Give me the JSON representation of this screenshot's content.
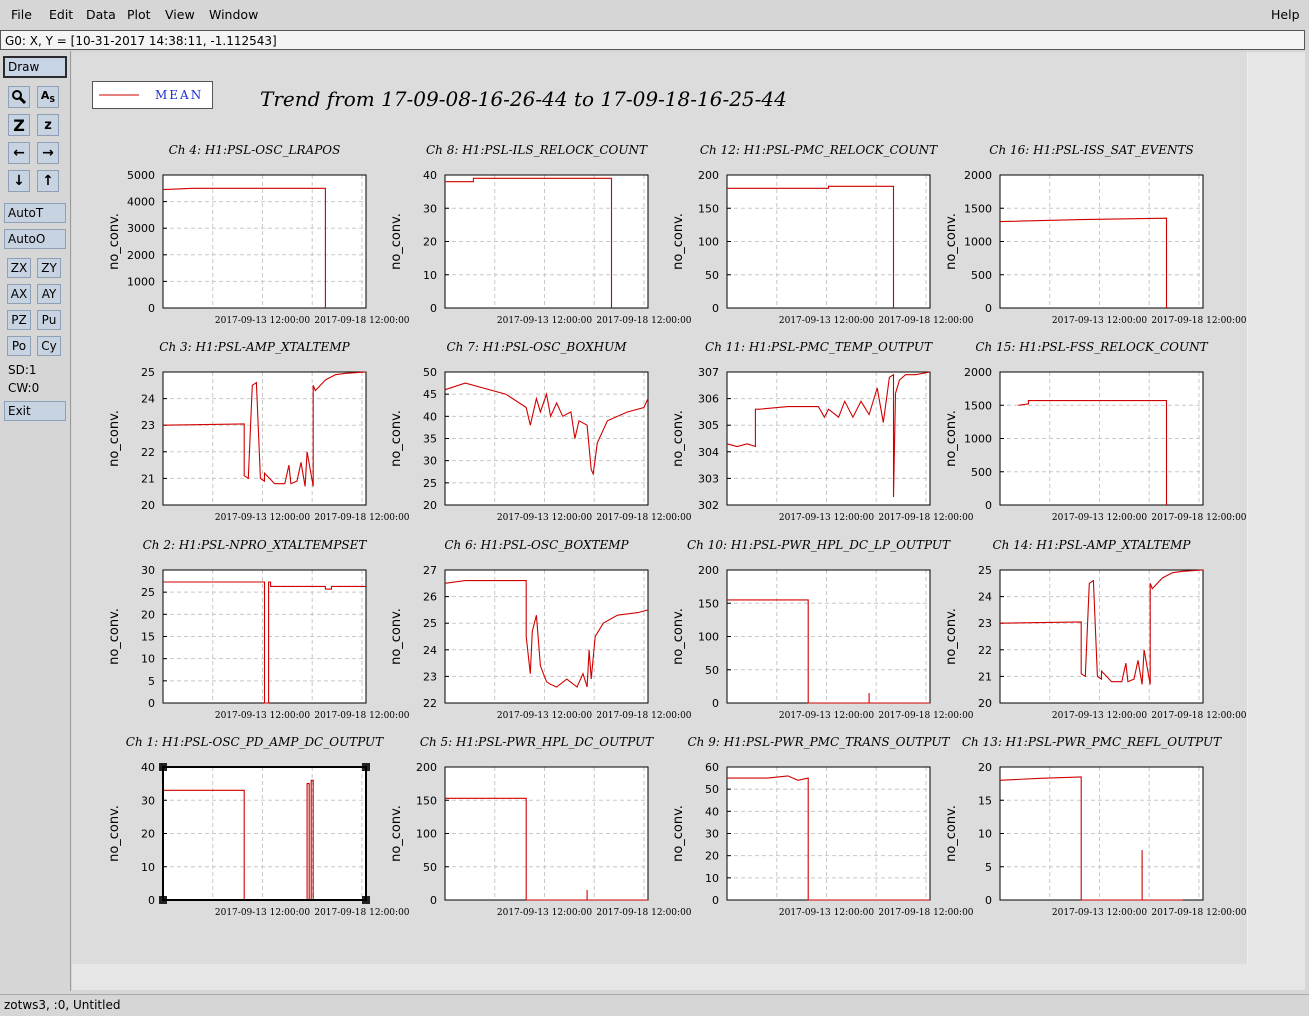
{
  "menubar": {
    "items": [
      "File",
      "Edit",
      "Data",
      "Plot",
      "View",
      "Window"
    ],
    "help": "Help"
  },
  "coordbar": {
    "text": "G0: X, Y = [10-31-2017 14:38:11, -1.112543]"
  },
  "toolbar": {
    "draw": "Draw",
    "autot": "AutoT",
    "autoo": "AutoO",
    "grid_buttons": [
      "ZX",
      "ZY",
      "AX",
      "AY",
      "PZ",
      "Pu",
      "Po",
      "Cy"
    ],
    "sd": "SD:1",
    "cw": "CW:0",
    "exit": "Exit"
  },
  "legend": {
    "label": "MEAN",
    "color": "#d00000"
  },
  "title": "Trend from 17-09-08-16-26-44 to 17-09-18-16-25-44",
  "status": {
    "text": "zotws3, :0, Untitled"
  },
  "colors": {
    "trace": "#d00000",
    "grid": "#c8c8c8"
  },
  "chart_data": [
    {
      "type": "line",
      "title": "Ch 4: H1:PSL-OSC_LRAPOS",
      "ylabel": "no_conv.",
      "ylim": [
        0,
        5000
      ],
      "yticks": [
        0,
        1000,
        2000,
        3000,
        4000,
        5000
      ],
      "xticks": [
        "2017-09-13 12:00:00",
        "2017-09-18 12:00:00"
      ],
      "x": [
        0,
        0.15,
        0.8,
        0.8
      ],
      "y": [
        4450,
        4500,
        4500,
        0
      ]
    },
    {
      "type": "line",
      "title": "Ch 8: H1:PSL-ILS_RELOCK_COUNT",
      "ylabel": "no_conv.",
      "ylim": [
        0,
        40
      ],
      "yticks": [
        0,
        10,
        20,
        30,
        40
      ],
      "xticks": [
        "2017-09-13 12:00:00",
        "2017-09-18 12:00:00"
      ],
      "x": [
        0,
        0.14,
        0.14,
        0.82,
        0.82
      ],
      "y": [
        38,
        38,
        39,
        39,
        0
      ]
    },
    {
      "type": "line",
      "title": "Ch 12: H1:PSL-PMC_RELOCK_COUNT",
      "ylabel": "no_conv.",
      "ylim": [
        0,
        200
      ],
      "yticks": [
        0,
        50,
        100,
        150,
        200
      ],
      "xticks": [
        "2017-09-13 12:00:00",
        "2017-09-18 12:00:00"
      ],
      "x": [
        0,
        0.5,
        0.5,
        0.82,
        0.82
      ],
      "y": [
        180,
        180,
        183,
        183,
        0
      ]
    },
    {
      "type": "line",
      "title": "Ch 16: H1:PSL-ISS_SAT_EVENTS",
      "ylabel": "no_conv.",
      "ylim": [
        0,
        2000
      ],
      "yticks": [
        0,
        500,
        1000,
        1500,
        2000
      ],
      "xticks": [
        "2017-09-13 12:00:00",
        "2017-09-18 12:00:00"
      ],
      "x": [
        0,
        0.4,
        0.82,
        0.82
      ],
      "y": [
        1300,
        1330,
        1350,
        0
      ]
    },
    {
      "type": "line",
      "title": "Ch 3: H1:PSL-AMP_XTALTEMP",
      "ylabel": "no_conv.",
      "ylim": [
        20,
        25
      ],
      "yticks": [
        20,
        21,
        22,
        23,
        24,
        25
      ],
      "xticks": [
        "2017-09-13 12:00:00",
        "2017-09-18 12:00:00"
      ],
      "x": [
        0,
        0.4,
        0.4,
        0.42,
        0.44,
        0.46,
        0.48,
        0.5,
        0.5,
        0.55,
        0.6,
        0.62,
        0.63,
        0.66,
        0.68,
        0.7,
        0.71,
        0.74,
        0.74,
        0.75,
        0.8,
        0.85,
        0.9,
        1.0
      ],
      "y": [
        23.0,
        23.05,
        21.1,
        21.0,
        24.5,
        24.6,
        21.0,
        20.9,
        21.2,
        20.8,
        20.8,
        21.5,
        20.8,
        20.9,
        21.6,
        20.7,
        22.0,
        20.7,
        24.5,
        24.3,
        24.7,
        24.9,
        24.95,
        25.0
      ]
    },
    {
      "type": "line",
      "title": "Ch 7: H1:PSL-OSC_BOXHUM",
      "ylabel": "no_conv.",
      "ylim": [
        20,
        50
      ],
      "yticks": [
        20,
        25,
        30,
        35,
        40,
        45,
        50
      ],
      "xticks": [
        "2017-09-13 12:00:00",
        "2017-09-18 12:00:00"
      ],
      "x": [
        0,
        0.1,
        0.3,
        0.4,
        0.42,
        0.45,
        0.47,
        0.5,
        0.52,
        0.55,
        0.58,
        0.62,
        0.64,
        0.66,
        0.7,
        0.72,
        0.73,
        0.75,
        0.8,
        0.9,
        0.98,
        1.0
      ],
      "y": [
        46,
        47.5,
        45,
        42,
        38,
        44,
        41,
        45,
        40,
        43,
        40,
        41,
        35,
        39,
        38,
        28,
        27,
        34,
        39,
        41,
        42,
        44
      ]
    },
    {
      "type": "line",
      "title": "Ch 11: H1:PSL-PMC_TEMP_OUTPUT",
      "ylabel": "no_conv.",
      "ylim": [
        302,
        307
      ],
      "yticks": [
        302,
        303,
        304,
        305,
        306,
        307
      ],
      "xticks": [
        "2017-09-13 12:00:00",
        "2017-09-18 12:00:00"
      ],
      "x": [
        0,
        0.05,
        0.1,
        0.14,
        0.14,
        0.16,
        0.3,
        0.45,
        0.48,
        0.5,
        0.55,
        0.58,
        0.62,
        0.66,
        0.7,
        0.74,
        0.77,
        0.8,
        0.82,
        0.82,
        0.83,
        0.85,
        0.88,
        0.93,
        1.0
      ],
      "y": [
        304.3,
        304.2,
        304.3,
        304.2,
        305.6,
        305.6,
        305.7,
        305.7,
        305.3,
        305.6,
        305.3,
        305.9,
        305.3,
        305.9,
        305.4,
        306.4,
        305.1,
        306.8,
        306.9,
        302.3,
        306.2,
        306.7,
        306.9,
        306.9,
        307.0
      ]
    },
    {
      "type": "line",
      "title": "Ch 15: H1:PSL-FSS_RELOCK_COUNT",
      "ylabel": "no_conv.",
      "ylim": [
        0,
        2000
      ],
      "yticks": [
        0,
        500,
        1000,
        1500,
        2000
      ],
      "xticks": [
        "2017-09-13 12:00:00",
        "2017-09-18 12:00:00"
      ],
      "x": [
        0.09,
        0.14,
        0.14,
        0.82,
        0.82
      ],
      "y": [
        1500,
        1520,
        1570,
        1570,
        0
      ]
    },
    {
      "type": "line",
      "title": "Ch 2: H1:PSL-NPRO_XTALTEMPSET",
      "ylabel": "no_conv.",
      "ylim": [
        0,
        30
      ],
      "yticks": [
        0,
        5,
        10,
        15,
        20,
        25,
        30
      ],
      "xticks": [
        "2017-09-13 12:00:00",
        "2017-09-18 12:00:00"
      ],
      "x": [
        0,
        0.5,
        0.5,
        0.52,
        0.52,
        0.53,
        0.53,
        0.8,
        0.8,
        0.83,
        0.83,
        1.0
      ],
      "y": [
        27.3,
        27.3,
        0,
        0,
        27.3,
        27.3,
        26.3,
        26.3,
        25.7,
        25.7,
        26.3,
        26.3
      ]
    },
    {
      "type": "line",
      "title": "Ch 6: H1:PSL-OSC_BOXTEMP",
      "ylabel": "no_conv.",
      "ylim": [
        22,
        27
      ],
      "yticks": [
        22,
        23,
        24,
        25,
        26,
        27
      ],
      "xticks": [
        "2017-09-13 12:00:00",
        "2017-09-18 12:00:00"
      ],
      "x": [
        0,
        0.1,
        0.3,
        0.4,
        0.4,
        0.42,
        0.43,
        0.45,
        0.47,
        0.5,
        0.52,
        0.55,
        0.6,
        0.65,
        0.68,
        0.7,
        0.71,
        0.72,
        0.74,
        0.78,
        0.85,
        0.95,
        1.0
      ],
      "y": [
        26.5,
        26.6,
        26.6,
        26.6,
        24.5,
        23.1,
        24.7,
        25.3,
        23.4,
        22.8,
        22.7,
        22.6,
        22.9,
        22.6,
        23.1,
        22.6,
        24.0,
        22.9,
        24.5,
        25.0,
        25.3,
        25.4,
        25.5
      ]
    },
    {
      "type": "line",
      "title": "Ch 10: H1:PSL-PWR_HPL_DC_LP_OUTPUT",
      "ylabel": "no_conv.",
      "ylim": [
        0,
        200
      ],
      "yticks": [
        0,
        50,
        100,
        150,
        200
      ],
      "xticks": [
        "2017-09-13 12:00:00",
        "2017-09-18 12:00:00"
      ],
      "x": [
        0,
        0.4,
        0.4,
        0.7,
        0.7,
        0.7,
        0.7,
        1.0
      ],
      "y": [
        155,
        155,
        0,
        0,
        15,
        15,
        0,
        0
      ]
    },
    {
      "type": "line",
      "title": "Ch 14: H1:PSL-AMP_XTALTEMP",
      "ylabel": "no_conv.",
      "ylim": [
        20,
        25
      ],
      "yticks": [
        20,
        21,
        22,
        23,
        24,
        25
      ],
      "xticks": [
        "2017-09-13 12:00:00",
        "2017-09-18 12:00:00"
      ],
      "x": [
        0,
        0.4,
        0.4,
        0.42,
        0.44,
        0.46,
        0.48,
        0.5,
        0.5,
        0.55,
        0.6,
        0.62,
        0.63,
        0.66,
        0.68,
        0.7,
        0.71,
        0.74,
        0.74,
        0.75,
        0.8,
        0.85,
        0.9,
        1.0
      ],
      "y": [
        23.0,
        23.05,
        21.1,
        21.0,
        24.5,
        24.6,
        21.0,
        20.9,
        21.2,
        20.8,
        20.8,
        21.5,
        20.8,
        20.9,
        21.6,
        20.7,
        22.0,
        20.7,
        24.5,
        24.3,
        24.7,
        24.9,
        24.95,
        25.0
      ]
    },
    {
      "type": "line",
      "title": "Ch 1: H1:PSL-OSC_PD_AMP_DC_OUTPUT",
      "ylabel": "no_conv.",
      "ylim": [
        0,
        40
      ],
      "yticks": [
        0,
        10,
        20,
        30,
        40
      ],
      "xticks": [
        "2017-09-13 12:00:00",
        "2017-09-18 12:00:00"
      ],
      "x": [
        0,
        0.4,
        0.4,
        0.71,
        0.71,
        0.72,
        0.72,
        0.73,
        0.73,
        0.74,
        0.74,
        1.0
      ],
      "y": [
        33,
        33,
        0,
        0,
        35,
        35,
        0,
        0,
        36,
        36,
        0,
        0
      ]
    },
    {
      "type": "line",
      "title": "Ch 5: H1:PSL-PWR_HPL_DC_OUTPUT",
      "ylabel": "no_conv.",
      "ylim": [
        0,
        200
      ],
      "yticks": [
        0,
        50,
        100,
        150,
        200
      ],
      "xticks": [
        "2017-09-13 12:00:00",
        "2017-09-18 12:00:00"
      ],
      "x": [
        0,
        0.4,
        0.4,
        0.7,
        0.7,
        0.7,
        0.7,
        1.0
      ],
      "y": [
        153,
        153,
        0,
        0,
        15,
        15,
        0,
        0
      ]
    },
    {
      "type": "line",
      "title": "Ch 9: H1:PSL-PWR_PMC_TRANS_OUTPUT",
      "ylabel": "no_conv.",
      "ylim": [
        0,
        60
      ],
      "yticks": [
        0,
        10,
        20,
        30,
        40,
        50,
        60
      ],
      "xticks": [
        "2017-09-13 12:00:00",
        "2017-09-18 12:00:00"
      ],
      "x": [
        0,
        0.2,
        0.3,
        0.35,
        0.4,
        0.4,
        1.0
      ],
      "y": [
        55,
        55,
        56,
        54,
        55,
        0,
        0
      ]
    },
    {
      "type": "line",
      "title": "Ch 13: H1:PSL-PWR_PMC_REFL_OUTPUT",
      "ylabel": "no_conv.",
      "ylim": [
        0,
        20
      ],
      "yticks": [
        0,
        5,
        10,
        15,
        20
      ],
      "xticks": [
        "2017-09-13 12:00:00",
        "2017-09-18 12:00:00"
      ],
      "x": [
        0,
        0.2,
        0.4,
        0.4,
        0.7,
        0.7,
        0.7,
        0.9
      ],
      "y": [
        18,
        18.3,
        18.5,
        0,
        0,
        7.5,
        0,
        0
      ]
    }
  ]
}
